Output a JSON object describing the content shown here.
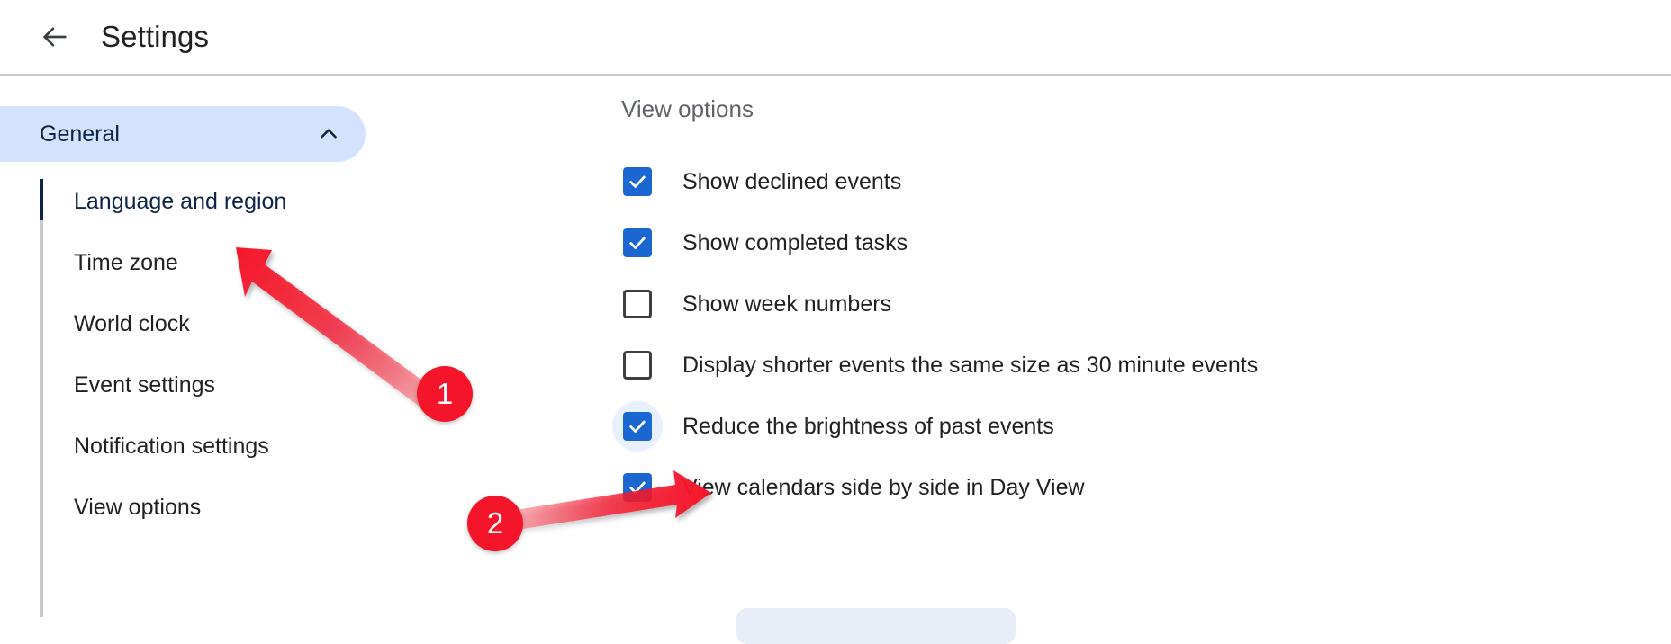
{
  "header": {
    "back_icon": "back-arrow-icon",
    "title": "Settings"
  },
  "sidebar": {
    "group": {
      "label": "General",
      "expanded": true,
      "chevron_icon": "chevron-up-icon"
    },
    "items": [
      {
        "label": "Language and region",
        "active": true
      },
      {
        "label": "Time zone",
        "active": false
      },
      {
        "label": "World clock",
        "active": false
      },
      {
        "label": "Event settings",
        "active": false
      },
      {
        "label": "Notification settings",
        "active": false
      },
      {
        "label": "View options",
        "active": false
      }
    ]
  },
  "main": {
    "section_title": "View options",
    "options": [
      {
        "label": "Show declined events",
        "checked": true,
        "focused": false
      },
      {
        "label": "Show completed tasks",
        "checked": true,
        "focused": false
      },
      {
        "label": "Show week numbers",
        "checked": false,
        "focused": false
      },
      {
        "label": "Display shorter events the same size as 30 minute events",
        "checked": false,
        "focused": false
      },
      {
        "label": "Reduce the brightness of past events",
        "checked": true,
        "focused": true
      },
      {
        "label": "View calendars side by side in Day View",
        "checked": true,
        "focused": false
      }
    ]
  },
  "annotations": {
    "color": "#f5152b",
    "markers": [
      {
        "number": "1",
        "target": "Language and region"
      },
      {
        "number": "2",
        "target": "Reduce the brightness of past events checkbox"
      }
    ]
  }
}
